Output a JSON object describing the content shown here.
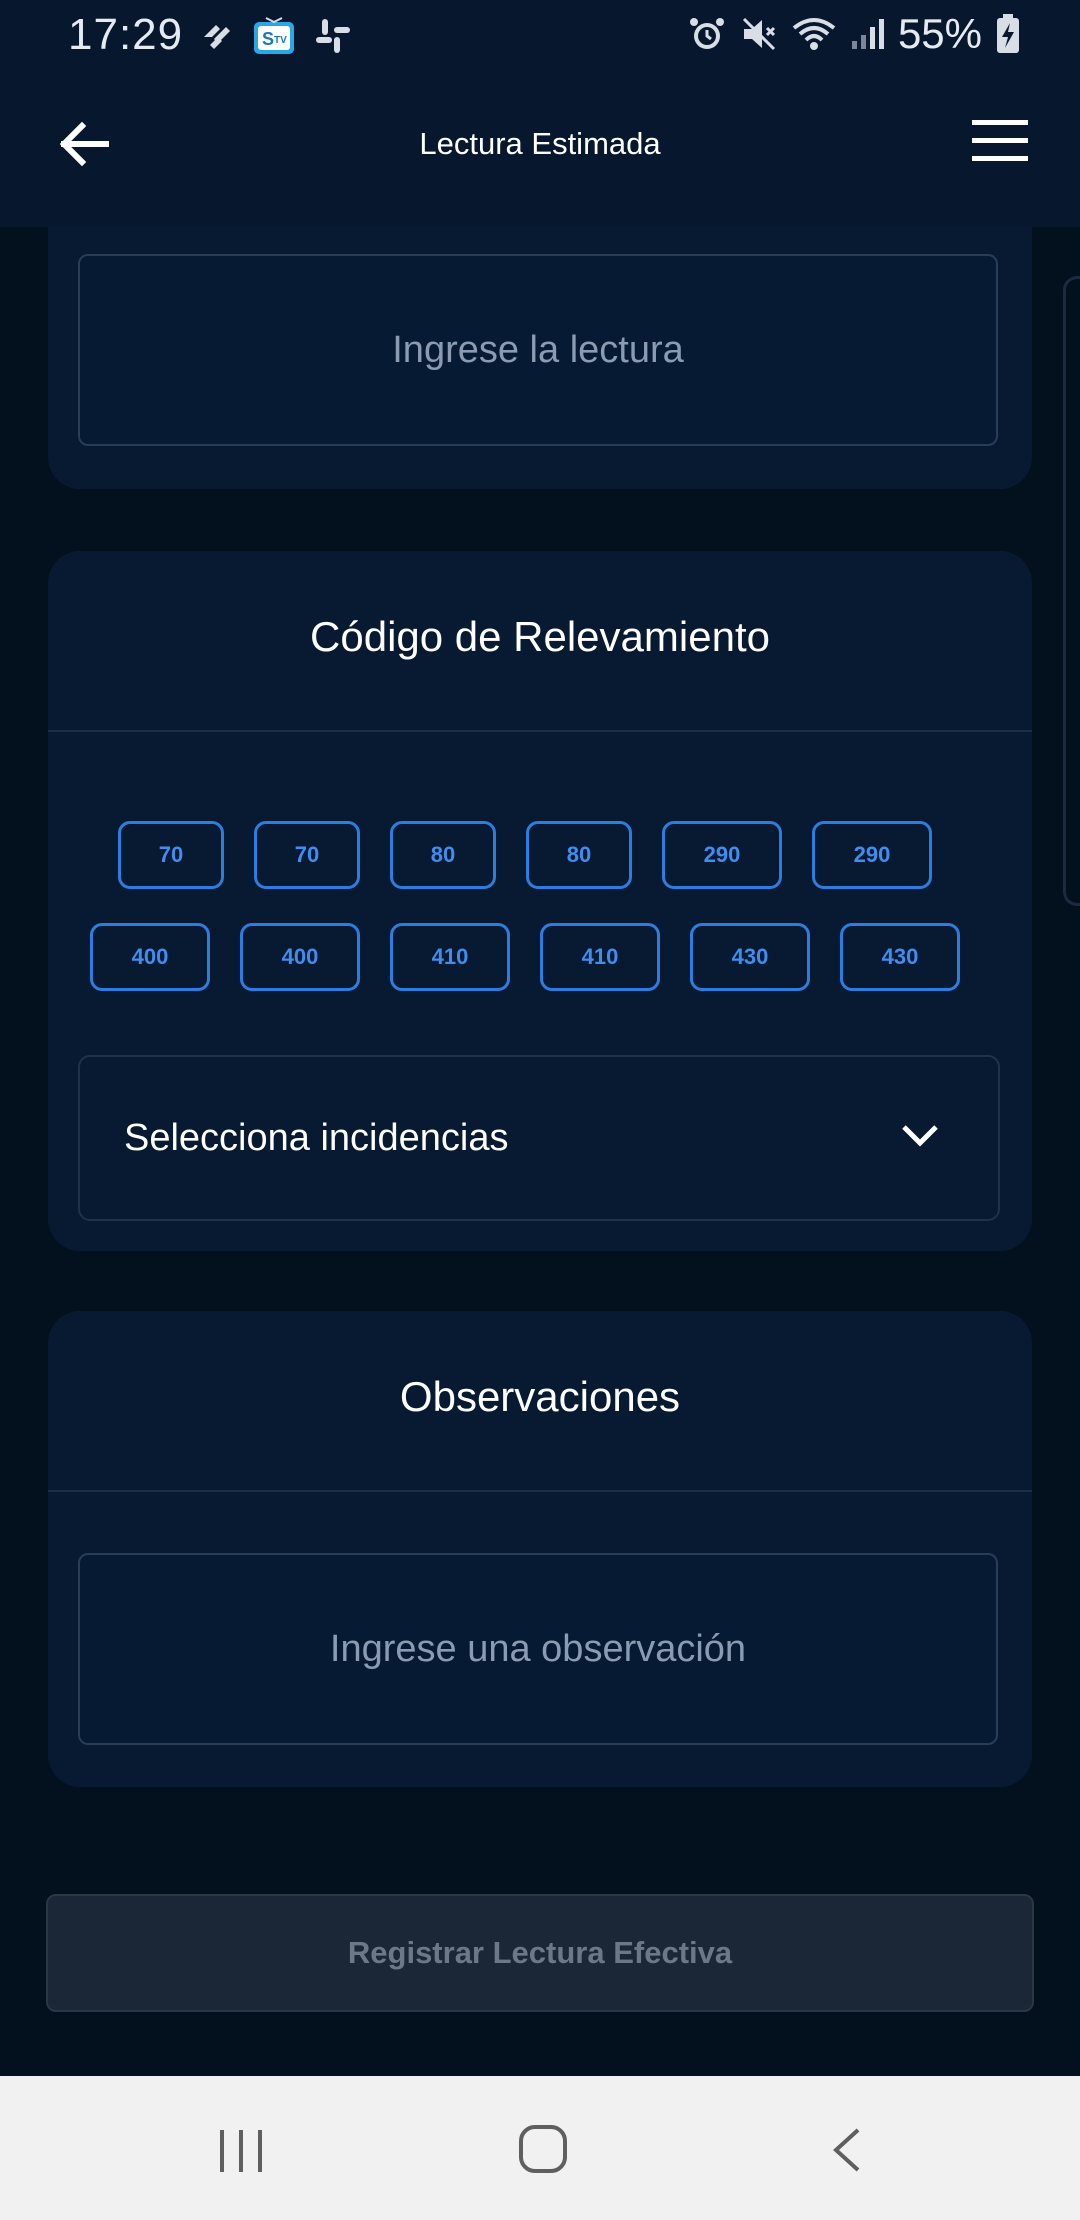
{
  "status_bar": {
    "time": "17:29",
    "battery_percent": "55%",
    "icons": [
      "app-notification-icon",
      "tv-app-icon",
      "slack-icon",
      "alarm-icon",
      "mute-icon",
      "wifi-icon",
      "signal-icon",
      "battery-charging-icon"
    ]
  },
  "header": {
    "title": "Lectura Estimada",
    "back_icon": "arrow-left-icon",
    "menu_icon": "hamburger-menu-icon"
  },
  "reading": {
    "placeholder": "Ingrese la lectura"
  },
  "codes": {
    "title": "Código de Relevamiento",
    "row1": [
      "70",
      "70",
      "80",
      "80",
      "290",
      "290"
    ],
    "row2": [
      "400",
      "400",
      "410",
      "410",
      "430",
      "430"
    ],
    "dropdown_label": "Selecciona incidencias"
  },
  "observations": {
    "title": "Observaciones",
    "placeholder": "Ingrese una observación"
  },
  "submit": {
    "label": "Registrar Lectura Efectiva"
  },
  "colors": {
    "background": "#03111f",
    "card": "#071a31",
    "accent": "#2c7de0",
    "disabled_button": "#1b2637"
  }
}
